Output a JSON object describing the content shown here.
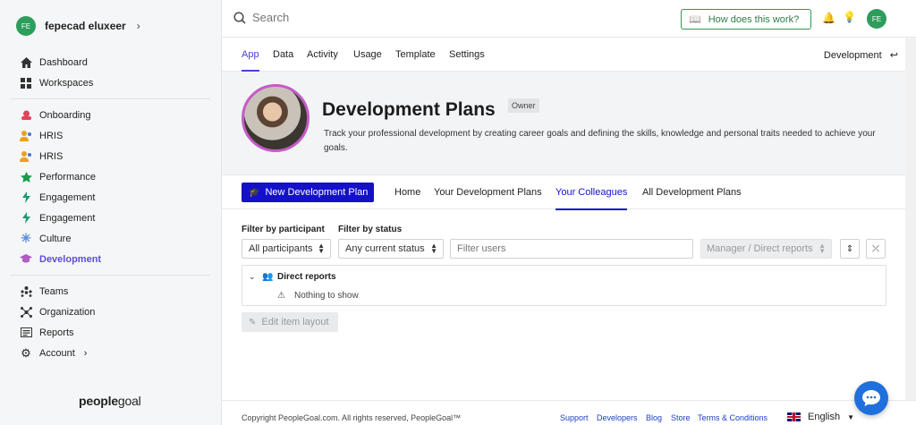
{
  "user": {
    "initials": "FE",
    "name": "fepecad eluxeer"
  },
  "sidebar": {
    "group1": [
      {
        "label": "Dashboard",
        "icon": "home-icon"
      },
      {
        "label": "Workspaces",
        "icon": "grid-icon"
      }
    ],
    "group2": [
      {
        "label": "Onboarding",
        "icon": "onboarding-icon"
      },
      {
        "label": "HRIS",
        "icon": "people-icon"
      },
      {
        "label": "HRIS",
        "icon": "people-icon"
      },
      {
        "label": "Performance",
        "icon": "star-icon"
      },
      {
        "label": "Engagement",
        "icon": "bolt-icon"
      },
      {
        "label": "Engagement",
        "icon": "bolt-icon"
      },
      {
        "label": "Culture",
        "icon": "asterisk-icon"
      },
      {
        "label": "Development",
        "icon": "graduation-cap-icon",
        "active": true
      }
    ],
    "group3": [
      {
        "label": "Teams",
        "icon": "teams-icon"
      },
      {
        "label": "Organization",
        "icon": "org-icon"
      },
      {
        "label": "Reports",
        "icon": "reports-icon"
      },
      {
        "label": "Account",
        "icon": "gear-icon"
      }
    ],
    "brand": {
      "bold": "people",
      "rest": "goal"
    }
  },
  "topbar": {
    "search_placeholder": "Search",
    "how_label": "How does this work?",
    "avatar_initials": "FE"
  },
  "tabs": [
    "App",
    "Data",
    "Activity",
    "Usage",
    "Template",
    "Settings"
  ],
  "tabs_right": "Development",
  "hero": {
    "title": "Development Plans",
    "badge": "Owner",
    "description": "Track your professional development by creating career goals and defining the skills, knowledge and personal traits needed to achieve your goals."
  },
  "subnav": {
    "new_button": "New Development Plan",
    "links": [
      "Home",
      "Your Development Plans",
      "Your Colleagues",
      "All Development Plans"
    ],
    "active": "Your Colleagues"
  },
  "filters": {
    "participant_label": "Filter by participant",
    "status_label": "Filter by status",
    "participant_value": "All participants",
    "status_value": "Any current status",
    "users_placeholder": "Filter users",
    "manager_value": "Manager / Direct reports"
  },
  "list": {
    "group_title": "Direct reports",
    "empty_text": "Nothing to show"
  },
  "edit_layout_label": "Edit item layout",
  "footer": {
    "copyright": "Copyright PeopleGoal.com. All rights reserved, PeopleGoal™",
    "links": [
      "Support",
      "Developers",
      "Blog",
      "Store",
      "Terms & Conditions"
    ],
    "language": "English"
  },
  "colors": {
    "accent": "#1411c9",
    "green": "#2e9a55",
    "active_nav": "#5a4fd6"
  }
}
